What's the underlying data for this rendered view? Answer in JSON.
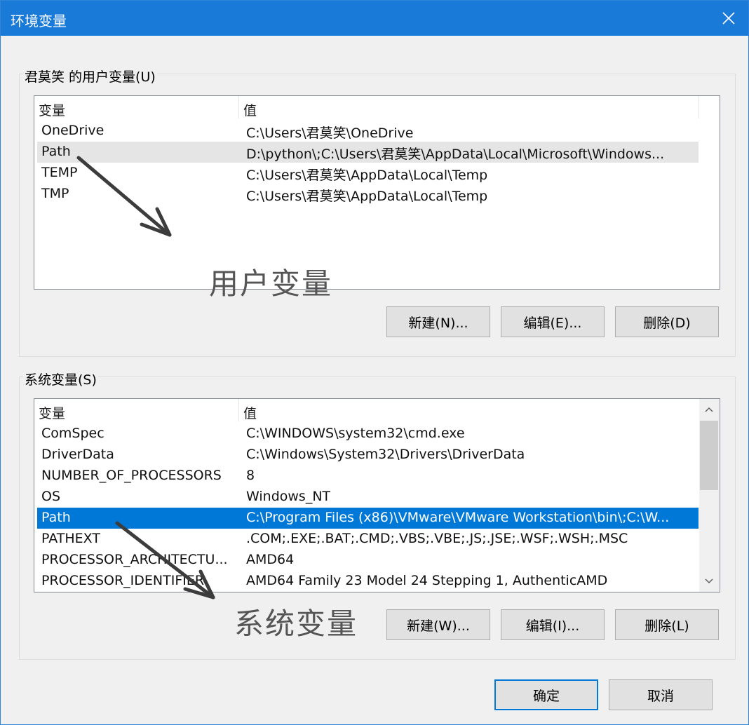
{
  "window": {
    "title": "环境变量"
  },
  "user_vars": {
    "group_label": "君莫笑 的用户变量(U)",
    "columns": [
      "变量",
      "值"
    ],
    "rows": [
      {
        "name": "OneDrive",
        "value": "C:\\Users\\君莫笑\\OneDrive"
      },
      {
        "name": "Path",
        "value": "D:\\python\\;C:\\Users\\君莫笑\\AppData\\Local\\Microsoft\\Windows..."
      },
      {
        "name": "TEMP",
        "value": "C:\\Users\\君莫笑\\AppData\\Local\\Temp"
      },
      {
        "name": "TMP",
        "value": "C:\\Users\\君莫笑\\AppData\\Local\\Temp"
      }
    ],
    "highlighted_row": "Path",
    "buttons": {
      "new": "新建(N)...",
      "edit": "编辑(E)...",
      "delete": "删除(D)"
    },
    "annotation": "用户变量"
  },
  "system_vars": {
    "group_label": "系统变量(S)",
    "columns": [
      "变量",
      "值"
    ],
    "rows": [
      {
        "name": "ComSpec",
        "value": "C:\\WINDOWS\\system32\\cmd.exe"
      },
      {
        "name": "DriverData",
        "value": "C:\\Windows\\System32\\Drivers\\DriverData"
      },
      {
        "name": "NUMBER_OF_PROCESSORS",
        "value": "8"
      },
      {
        "name": "OS",
        "value": "Windows_NT"
      },
      {
        "name": "Path",
        "value": "C:\\Program Files (x86)\\VMware\\VMware Workstation\\bin\\;C:\\W..."
      },
      {
        "name": "PATHEXT",
        "value": ".COM;.EXE;.BAT;.CMD;.VBS;.VBE;.JS;.JSE;.WSF;.WSH;.MSC"
      },
      {
        "name": "PROCESSOR_ARCHITECTU...",
        "value": "AMD64"
      },
      {
        "name": "PROCESSOR_IDENTIFIER",
        "value": "AMD64 Family 23 Model 24 Stepping 1, AuthenticAMD"
      }
    ],
    "selected_row": "Path",
    "buttons": {
      "new": "新建(W)...",
      "edit": "编辑(I)...",
      "delete": "删除(L)"
    },
    "annotation": "系统变量"
  },
  "footer": {
    "ok": "确定",
    "cancel": "取消"
  },
  "colors": {
    "titlebar": "#1a7ad7",
    "selection": "#0078d7",
    "highlight": "#e5e5e5",
    "annotation": "#555555"
  },
  "icons": {
    "close": "close-icon",
    "scroll_up": "chevron-up-icon",
    "scroll_down": "chevron-down-icon",
    "arrows": "arrow-icon"
  }
}
